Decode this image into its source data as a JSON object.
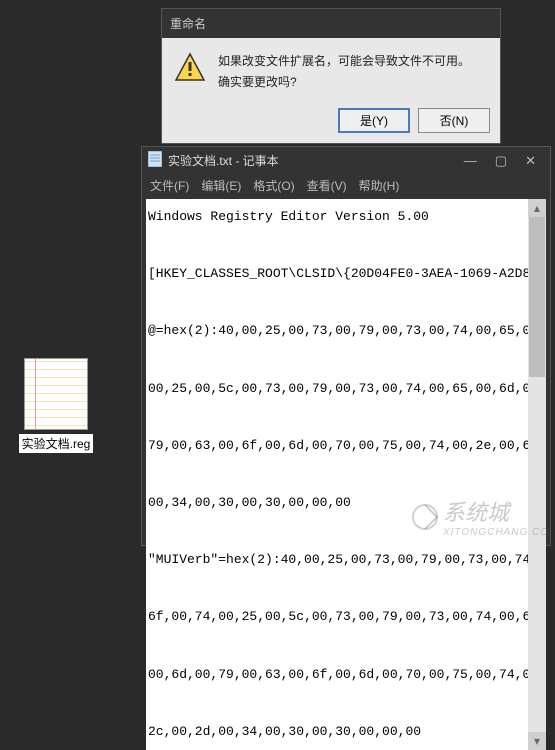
{
  "dialog": {
    "title": "重命名",
    "message_line1": "如果改变文件扩展名，可能会导致文件不可用。",
    "message_line2": "确实要更改吗?",
    "yes_label": "是(Y)",
    "no_label": "否(N)"
  },
  "notepad": {
    "title": "实验文档.txt - 记事本",
    "menu": {
      "file": "文件(F)",
      "edit": "编辑(E)",
      "format": "格式(O)",
      "view": "查看(V)",
      "help": "帮助(H)"
    },
    "content": "Windows Registry Editor Version 5.00\n\n[HKEY_CLASSES_ROOT\\CLSID\\{20D04FE0-3AEA-1069-A2D8\n\n@=hex(2):40,00,25,00,73,00,79,00,73,00,74,00,65,0\n\n00,25,00,5c,00,73,00,79,00,73,00,74,00,65,00,6d,0\n\n79,00,63,00,6f,00,6d,00,70,00,75,00,74,00,2e,00,6\n\n00,34,00,30,00,30,00,00,00\n\n\"MUIVerb\"=hex(2):40,00,25,00,73,00,79,00,73,00,74\n\n6f,00,74,00,25,00,5c,00,73,00,79,00,73,00,74,00,6\n\n00,6d,00,79,00,63,00,6f,00,6d,00,70,00,75,00,74,0\n\n2c,00,2d,00,34,00,30,00,30,00,00,00\n"
  },
  "desktop_file": {
    "label": "实验文档.reg"
  },
  "watermark": {
    "text": "系统城",
    "sub": "XITONGCHANG.CO"
  }
}
